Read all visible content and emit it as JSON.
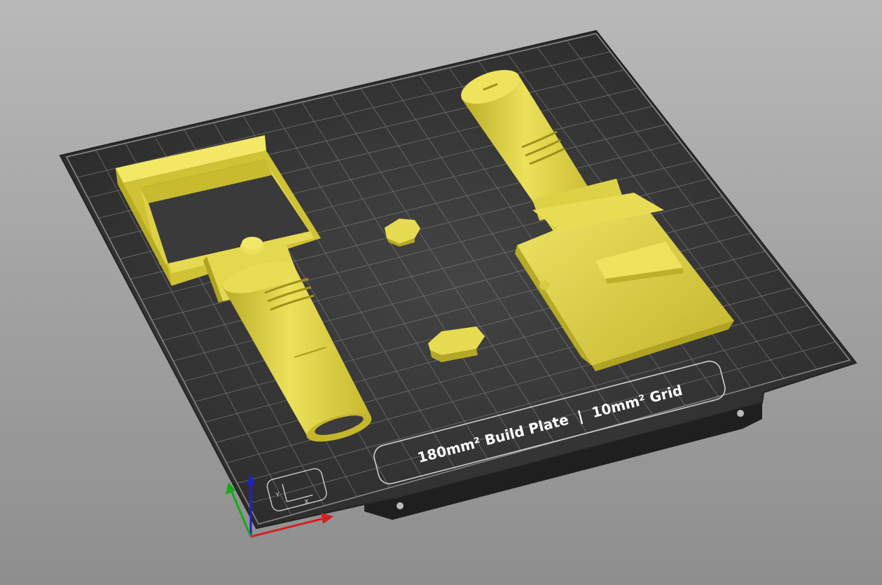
{
  "viewport": {
    "background_top": "#b9b9b9",
    "background_bottom": "#8e8e8e"
  },
  "build_plate": {
    "label": "180mm² Build Plate  |  10mm² Grid",
    "plate_color": "#2f2f2f",
    "grid_color": "#6a6a6a",
    "corner_icon_y": "Y",
    "corner_icon_x": "X"
  },
  "models": {
    "color": "#e0d43c",
    "items": [
      {
        "name": "handle-frame-part"
      },
      {
        "name": "cannon-barrel-part"
      },
      {
        "name": "small-peg-top"
      },
      {
        "name": "small-peg-bottom"
      }
    ]
  },
  "axes": {
    "x_color": "#d42020",
    "y_color": "#18a818",
    "z_color": "#2020c8"
  }
}
